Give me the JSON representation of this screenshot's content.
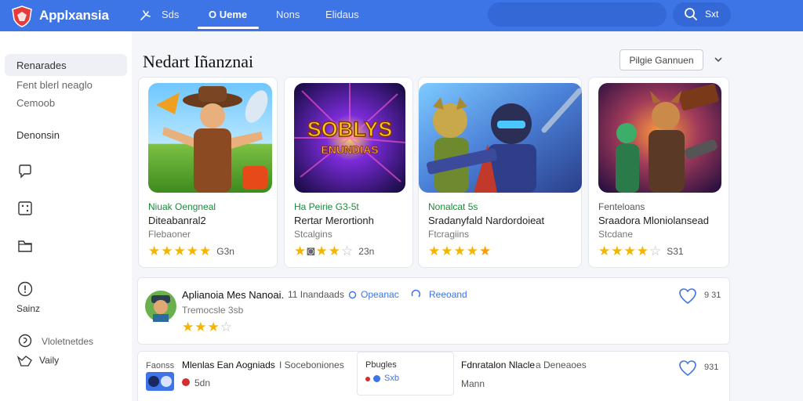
{
  "header": {
    "brand": "Applxansia",
    "nav": [
      "Sds",
      "O‌ Ueme",
      "Nons",
      "Elidaus"
    ],
    "active_nav_index": 1,
    "search_label": "Sxt",
    "colors": {
      "bar": "#3d74e6",
      "pill": "#3468d6"
    }
  },
  "sidebar": {
    "active_item": "Renarades",
    "sub_items": [
      "Fent blerl neaglo",
      "Cemoob"
    ],
    "section": "Denonsin",
    "icons": [
      "chat-bubble-icon",
      "dice-icon",
      "folder-icon",
      "info-icon",
      "settings-icon",
      "check-icon"
    ],
    "info_label": "Sainz",
    "bottom_items": [
      "Vloletnetdes",
      "Vaily"
    ]
  },
  "main": {
    "title": "Nedart Iñanznai",
    "sort_label": "Pilgie Gannuen",
    "cards": [
      {
        "line1": "Niuak Oengneal",
        "line2": "Diteabanral2",
        "line3": "Flebaoner",
        "rating": 4.5,
        "count": "G3n",
        "line1_color": "#1a8a3a"
      },
      {
        "line1": "Ha Peirie G3-5t",
        "line2": "Rertar Merortionh",
        "line3": "Stcalgins",
        "rating": 3.5,
        "count": "23n",
        "line1_color": "#1a8a3a",
        "image_text": [
          "SOBLYS",
          "ENUNDIAS"
        ]
      },
      {
        "line1": "Nonalcat 5s",
        "line2": "Sradanyfald Nardordoieat",
        "line3": "Ftcragiins",
        "rating": 5,
        "count": "",
        "line1_color": "#1a8a3a"
      },
      {
        "line1": "Fenteloans",
        "line2": "Sraadora Mloniolansead",
        "line3": "Stcdane",
        "rating": 4,
        "count": "S31",
        "line1_color": "#555555"
      }
    ],
    "row1": {
      "title": "Aplianoia Mes Nanoai.",
      "meta": "11 Inandaads",
      "link1": "Opeanac",
      "link2": "Reeoand",
      "subtitle": "Tremocsle 3sb",
      "rating": 3,
      "likes": "9 31"
    },
    "row2": {
      "label": "Faonss",
      "title": "Mlenlas Ean Aogniads",
      "meta": "I Soceboniones",
      "sub": "5dn",
      "box_title": "Pbugles",
      "box_sub": "Sxb",
      "right_title": "Fdnratalon Nlacle",
      "right_meta": "a Deneaoes",
      "right_sub": "Mann",
      "likes": "931"
    }
  }
}
